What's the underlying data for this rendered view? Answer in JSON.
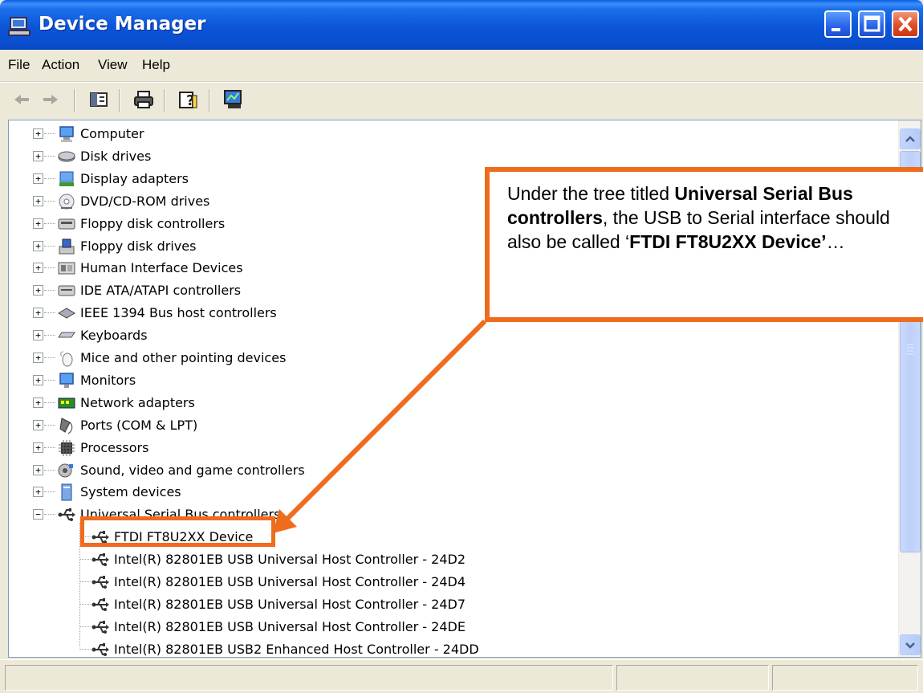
{
  "window": {
    "title": "Device Manager"
  },
  "menu": [
    "File",
    "Action",
    "View",
    "Help"
  ],
  "toolbar": {
    "icons": [
      "back-arrow-icon",
      "forward-arrow-icon",
      "properties-icon",
      "print-icon",
      "help-icon",
      "scan-hardware-icon"
    ]
  },
  "tree": {
    "categories": [
      {
        "label": "Computer",
        "icon": "computer-icon",
        "expanded": false
      },
      {
        "label": "Disk drives",
        "icon": "disk-drive-icon",
        "expanded": false
      },
      {
        "label": "Display adapters",
        "icon": "display-adapter-icon",
        "expanded": false
      },
      {
        "label": "DVD/CD-ROM drives",
        "icon": "dvd-drive-icon",
        "expanded": false
      },
      {
        "label": "Floppy disk controllers",
        "icon": "floppy-controller-icon",
        "expanded": false
      },
      {
        "label": "Floppy disk drives",
        "icon": "floppy-drive-icon",
        "expanded": false
      },
      {
        "label": "Human Interface Devices",
        "icon": "hid-icon",
        "expanded": false
      },
      {
        "label": "IDE ATA/ATAPI controllers",
        "icon": "ide-controller-icon",
        "expanded": false
      },
      {
        "label": "IEEE 1394 Bus host controllers",
        "icon": "ieee1394-icon",
        "expanded": false
      },
      {
        "label": "Keyboards",
        "icon": "keyboard-icon",
        "expanded": false
      },
      {
        "label": "Mice and other pointing devices",
        "icon": "mouse-icon",
        "expanded": false
      },
      {
        "label": "Monitors",
        "icon": "monitor-icon",
        "expanded": false
      },
      {
        "label": "Network adapters",
        "icon": "network-adapter-icon",
        "expanded": false
      },
      {
        "label": "Ports (COM & LPT)",
        "icon": "port-icon",
        "expanded": false
      },
      {
        "label": "Processors",
        "icon": "processor-icon",
        "expanded": false
      },
      {
        "label": "Sound, video and game controllers",
        "icon": "sound-icon",
        "expanded": false
      },
      {
        "label": "System devices",
        "icon": "system-device-icon",
        "expanded": false
      },
      {
        "label": "Universal Serial Bus controllers",
        "icon": "usb-icon",
        "expanded": true
      }
    ],
    "usb_children": [
      "FTDI FT8U2XX Device",
      "Intel(R) 82801EB USB Universal Host Controller - 24D2",
      "Intel(R) 82801EB USB Universal Host Controller - 24D4",
      "Intel(R) 82801EB USB Universal Host Controller - 24D7",
      "Intel(R) 82801EB USB Universal Host Controller - 24DE",
      "Intel(R) 82801EB USB2 Enhanced Host Controller - 24DD"
    ]
  },
  "callout": {
    "part1": "Under the tree titled ",
    "bold1": "Universal Serial Bus controllers",
    "part2": ", the USB to Serial interface should also be called ‘",
    "bold2": "FTDI FT8U2XX Device’",
    "part3": "…"
  },
  "colors": {
    "accent": "#ef6c1c",
    "titlebar": "#0a55d8"
  }
}
